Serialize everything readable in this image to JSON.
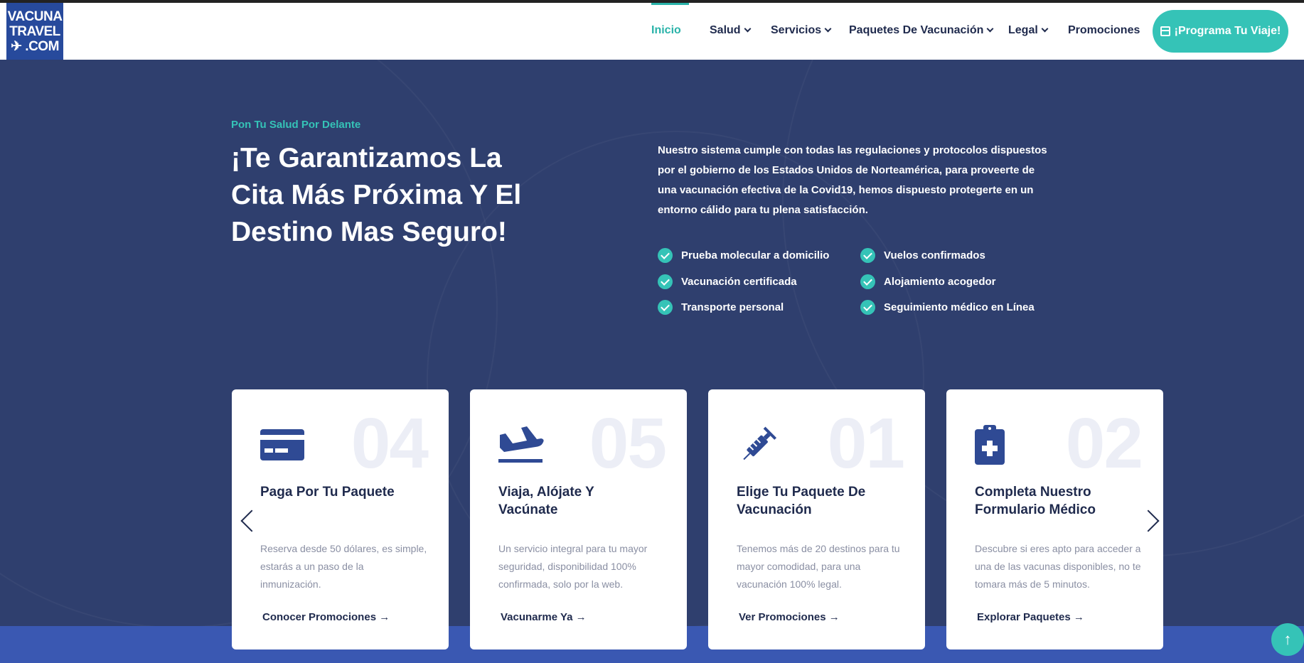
{
  "logo": {
    "line1": "VACUNA",
    "line2": "TRAVEL",
    "line3": "✈ .COM"
  },
  "nav": {
    "items": [
      {
        "label": "Inicio",
        "active": true,
        "dropdown": false
      },
      {
        "label": "Salud",
        "dropdown": true
      },
      {
        "label": "Servicios",
        "dropdown": true
      },
      {
        "label": "Paquetes De Vacunación",
        "dropdown": true
      },
      {
        "label": "Legal",
        "dropdown": true
      },
      {
        "label": "Promociones",
        "dropdown": false
      }
    ],
    "cta_label": "¡Programa Tu Viaje!"
  },
  "hero": {
    "eyebrow": "Pon Tu Salud Por Delante",
    "headline": "¡Te Garantizamos La Cita Más Próxima Y El Destino Mas Seguro!",
    "intro": "Nuestro sistema cumple con todas las regulaciones y protocolos dispuestos por el gobierno de los Estados Unidos de Norteamérica, para proveerte de una vacunación efectiva de la Covid19, hemos dispuesto protegerte en un entorno cálido para tu plena satisfacción.",
    "features": [
      "Prueba molecular a domicilio",
      "Vuelos confirmados",
      "Vacunación certificada",
      "Alojamiento acogedor",
      "Transporte personal",
      "Seguimiento médico en Línea"
    ]
  },
  "cards": [
    {
      "number": "04",
      "icon": "credit-card-icon",
      "title": "Paga Por Tu Paquete",
      "desc": "Reserva desde 50 dólares, es simple, estarás a un paso de la inmunización.",
      "link": "Conocer Promociones →"
    },
    {
      "number": "05",
      "icon": "plane-landing-icon",
      "title": "Viaja, Alójate Y Vacúnate",
      "desc": "Un servicio integral para tu mayor seguridad, disponibilidad 100% confirmada, solo por la web.",
      "link": "Vacunarme Ya →"
    },
    {
      "number": "01",
      "icon": "syringe-icon",
      "title": "Elige Tu Paquete De Vacunación",
      "desc": "Tenemos más de 20 destinos para tu mayor comodidad, para una vacunación 100% legal.",
      "link": "Ver Promociones →"
    },
    {
      "number": "02",
      "icon": "medical-clipboard-icon",
      "title": "Completa Nuestro Formulario Médico",
      "desc": "Descubre si eres apto para acceder a una de las vacunas disponibles, no te tomara más de 5 minutos.",
      "link": "Explorar Paquetes →"
    }
  ],
  "scroll_top_symbol": "↑",
  "colors": {
    "accent": "#35c3b7",
    "hero_bg": "#2f3f6e",
    "brand_blue": "#274a9c",
    "text_dark": "#1f2a4d"
  }
}
